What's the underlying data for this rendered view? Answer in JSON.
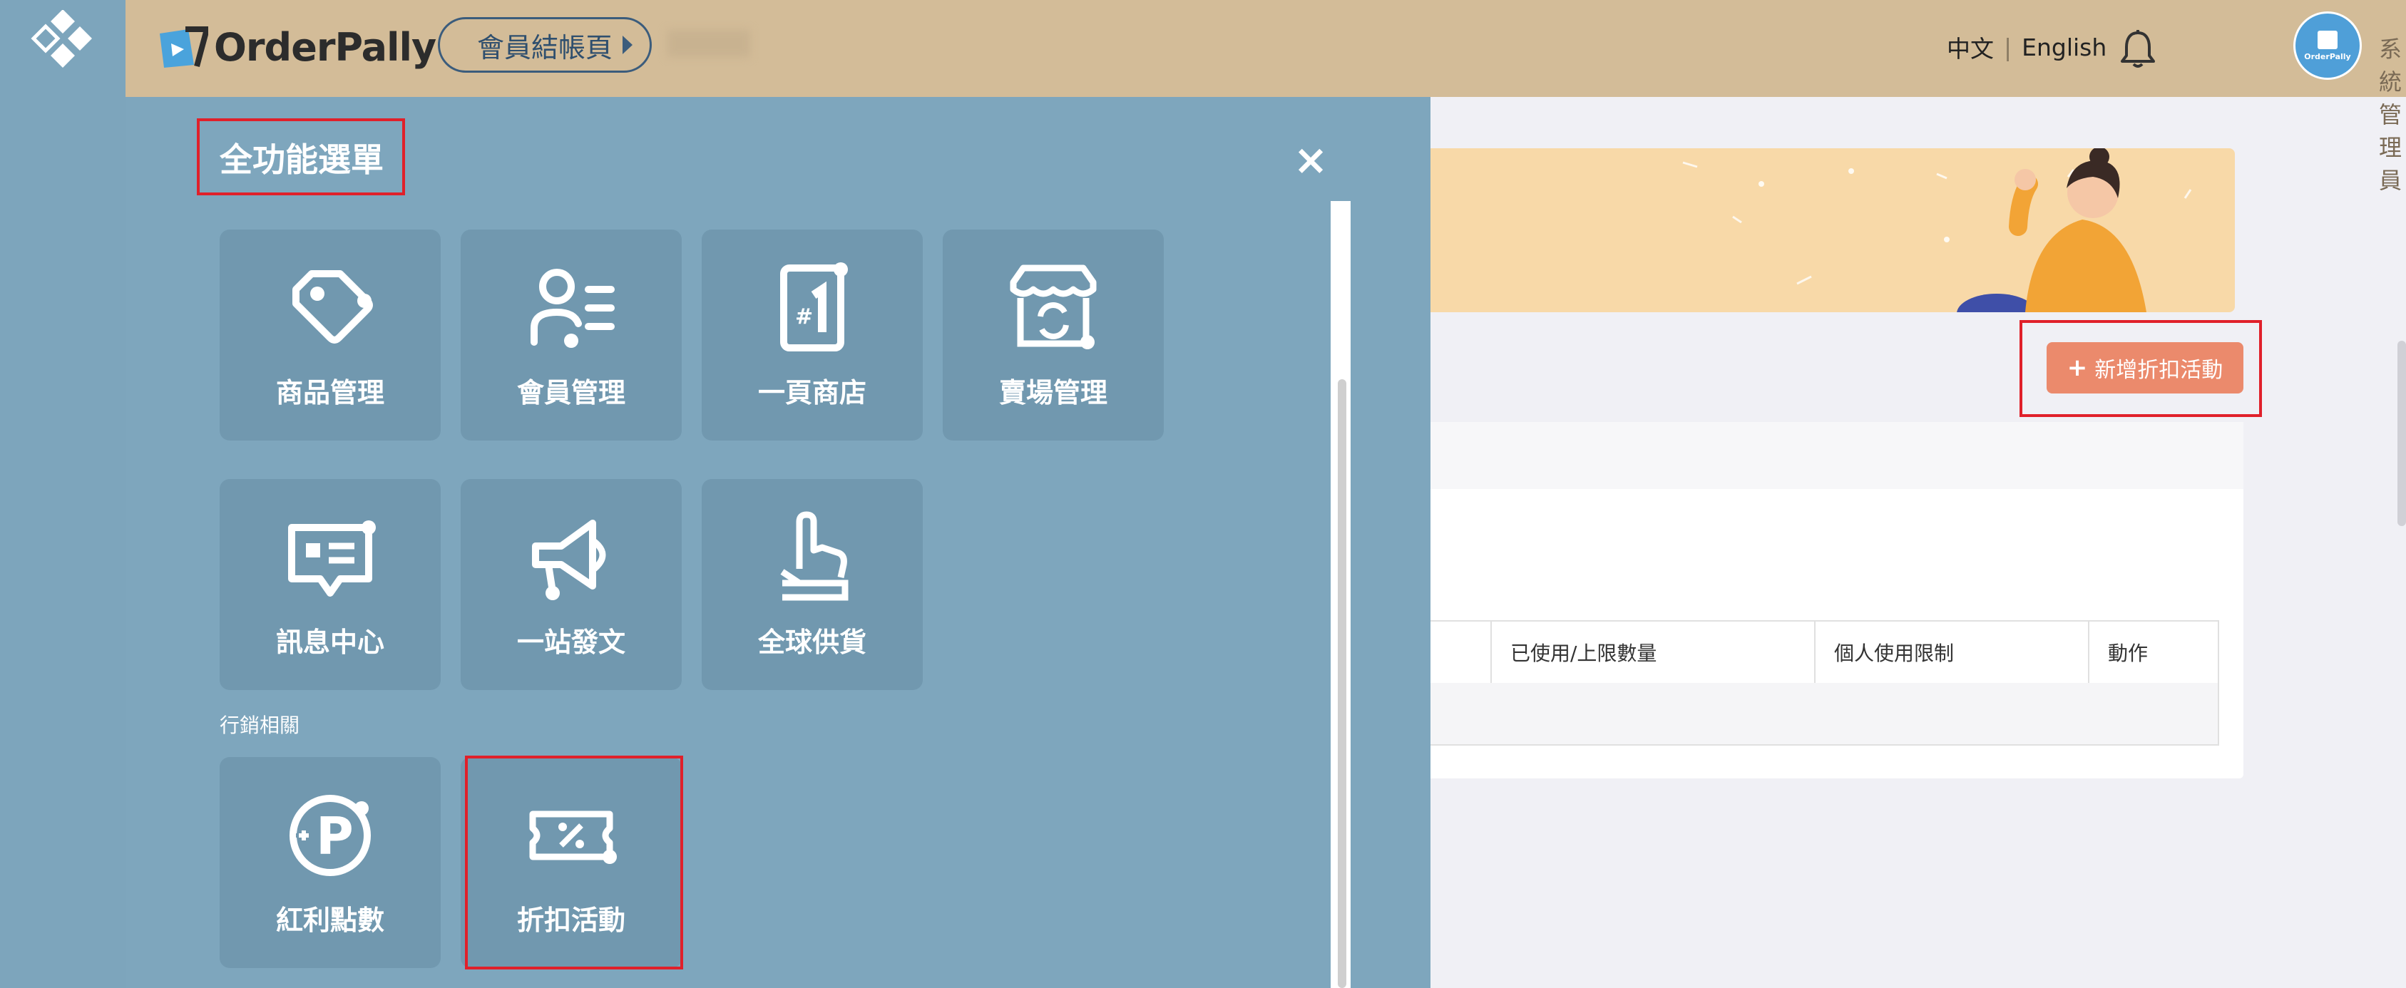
{
  "header": {
    "brand": "OrderPally",
    "page_pill": "會員結帳頁",
    "lang_zh": "中文",
    "lang_sep": "|",
    "lang_en": "English",
    "avatar_text": "OrderPally",
    "admin_name": "系統管理員"
  },
  "main": {
    "add_button": "新增折扣活動",
    "table_headers": [
      "已使用/上限數量",
      "個人使用限制",
      "動作"
    ]
  },
  "menu": {
    "title": "全功能選單",
    "close": "×",
    "tiles": [
      {
        "label": "商品管理",
        "icon": "tag-icon"
      },
      {
        "label": "會員管理",
        "icon": "member-list-icon"
      },
      {
        "label": "一頁商店",
        "icon": "one-page-store-icon"
      },
      {
        "label": "賣場管理",
        "icon": "storefront-icon"
      },
      {
        "label": "訊息中心",
        "icon": "message-icon"
      },
      {
        "label": "一站發文",
        "icon": "megaphone-icon"
      },
      {
        "label": "全球供貨",
        "icon": "pointing-hand-icon"
      }
    ],
    "section_label": "行銷相關",
    "marketing_tiles": [
      {
        "label": "紅利點數",
        "icon": "points-icon"
      },
      {
        "label": "折扣活動",
        "icon": "discount-ticket-icon"
      }
    ]
  },
  "colors": {
    "header_bg": "#d3bc98",
    "overlay_bg": "#7ea6bd",
    "tile_bg": "#7198af",
    "accent_button": "#eb8a6c",
    "highlight": "#e0202a"
  }
}
